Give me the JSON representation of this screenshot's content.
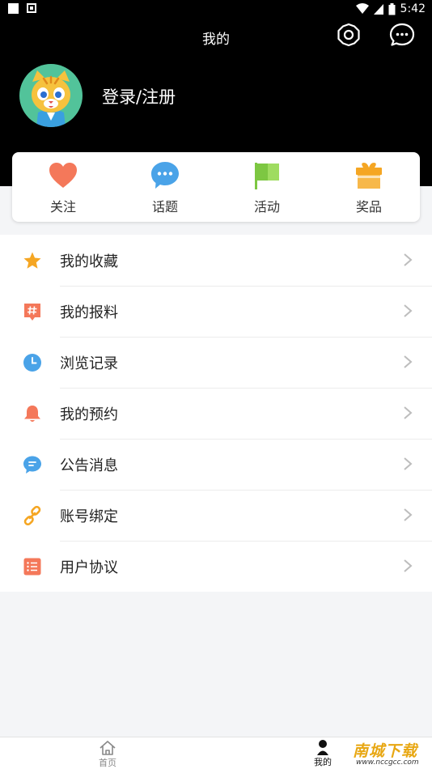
{
  "status_bar": {
    "time": "5:42"
  },
  "header": {
    "title": "我的",
    "login_text": "登录/注册"
  },
  "quick_actions": [
    {
      "label": "关注",
      "icon": "heart-icon",
      "color": "#f4785a"
    },
    {
      "label": "话题",
      "icon": "chat-bubble-icon",
      "color": "#4aa3e8"
    },
    {
      "label": "活动",
      "icon": "flag-icon",
      "color": "#7dc742"
    },
    {
      "label": "奖品",
      "icon": "gift-icon",
      "color": "#f5a623"
    }
  ],
  "menu": [
    {
      "label": "我的收藏",
      "icon": "star-icon",
      "color": "#f5a623"
    },
    {
      "label": "我的报料",
      "icon": "hashtag-icon",
      "color": "#f4785a"
    },
    {
      "label": " 浏览记录",
      "icon": "clock-icon",
      "color": "#4aa3e8"
    },
    {
      "label": "我的预约",
      "icon": "bell-icon",
      "color": "#f4785a"
    },
    {
      "label": "公告消息",
      "icon": "message-icon",
      "color": "#4aa3e8"
    },
    {
      "label": "账号绑定",
      "icon": "link-icon",
      "color": "#f5a623"
    },
    {
      "label": "用户协议",
      "icon": "list-icon",
      "color": "#f4785a"
    }
  ],
  "bottom_nav": {
    "home_label": "首页",
    "mine_label": "我的"
  },
  "watermark": {
    "brand": "南城下载",
    "url": "www.nccgcc.com"
  }
}
